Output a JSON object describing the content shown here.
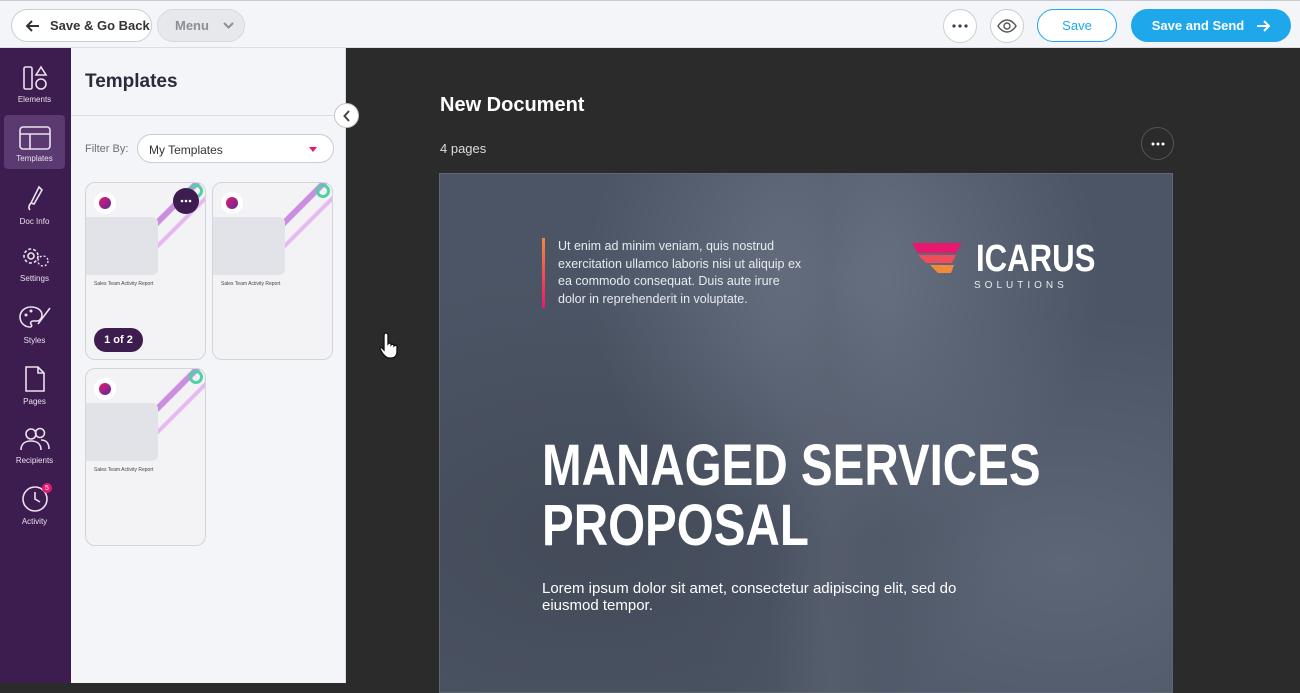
{
  "topbar": {
    "back_label": "Save & Go Back",
    "menu_label": "Menu",
    "more_icon": "more-horizontal-icon",
    "preview_icon": "eye-icon",
    "save_label": "Save",
    "send_label": "Save and Send"
  },
  "rail": {
    "items": [
      {
        "label": "Elements",
        "icon": "elements-icon"
      },
      {
        "label": "Templates",
        "icon": "templates-icon",
        "active": true
      },
      {
        "label": "Doc Info",
        "icon": "pen-icon"
      },
      {
        "label": "Settings",
        "icon": "gear-icon"
      },
      {
        "label": "Styles",
        "icon": "palette-icon"
      },
      {
        "label": "Pages",
        "icon": "page-icon"
      },
      {
        "label": "Recipients",
        "icon": "users-icon"
      },
      {
        "label": "Activity",
        "icon": "clock-icon",
        "badge": "5"
      }
    ]
  },
  "panel": {
    "title": "Templates",
    "filter_label": "Filter By:",
    "filter_value": "My Templates",
    "templates": [
      {
        "name": "Sales Team Activity Report",
        "pager": "1 of 2"
      },
      {
        "name": "Sales Team Activity Report"
      },
      {
        "name": "Sales Team Activity Report"
      }
    ]
  },
  "document": {
    "title": "New Document",
    "pages": "4 pages",
    "quote": "Ut enim ad minim veniam, quis nostrud exercitation ullamco laboris nisi ut aliquip ex ea commodo consequat. Duis aute irure dolor in reprehenderit in voluptate.",
    "brand_name": "ICARUS",
    "brand_sub": "SOLUTIONS",
    "headline_1": "MANAGED SERVICES",
    "headline_2": "PROPOSAL",
    "subline": "Lorem ipsum dolor sit amet, consectetur adipiscing elit, sed do eiusmod tempor."
  },
  "colors": {
    "accent": "#1ea7ea",
    "rail": "#3d1d4f",
    "brand_pink": "#e8186e"
  }
}
